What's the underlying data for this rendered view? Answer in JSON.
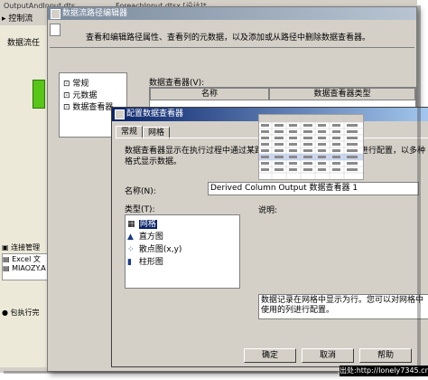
{
  "ide": {
    "tabs": [
      "OutputAndInput.dtsx [设计]*",
      "ForeachInput.dtsx [设计]*"
    ],
    "side_title": "控制流",
    "side_label": "数据流任",
    "bottom_items": [
      "连接管理",
      "Excel 文",
      "MIAOZY.A",
      "包执行完"
    ]
  },
  "path_editor": {
    "title": "数据流路径编辑器",
    "description": "查看和编辑路径属性、查看列的元数据，以及添加或从路径中删除数据查看器。",
    "tree": [
      "常规",
      "元数据",
      "数据查看器"
    ],
    "viewers_label": "数据查看器(V):",
    "columns": [
      "名称",
      "数据查看器类型"
    ]
  },
  "viewer_dialog": {
    "title": "配置数据查看器",
    "tabs": [
      "常规",
      "网格"
    ],
    "description": "数据查看器显示在执行过程中通过某路径的数据流。可对该查看器进行配置，以多种格式显示数据。",
    "name_label": "名称(N):",
    "name_value": "Derived Column Output 数据查看器 1",
    "type_label": "类型(T):",
    "types": [
      {
        "label": "网格",
        "icon": "grid-icon",
        "selected": true
      },
      {
        "label": "直方图",
        "icon": "histogram-icon"
      },
      {
        "label": "散点图(x,y)",
        "icon": "scatter-icon"
      },
      {
        "label": "柱形图",
        "icon": "column-chart-icon"
      }
    ],
    "explain_label": "说明:",
    "explain_text": "数据记录在网格中显示为行。您可以对网格中使用的列进行配置。",
    "buttons": [
      "确定",
      "取消",
      "帮助"
    ]
  },
  "watermark": "出处:http://lonely7345.cnblogs.com"
}
